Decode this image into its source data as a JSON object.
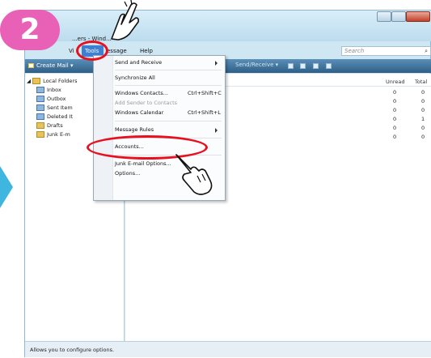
{
  "step_badge": "2",
  "window": {
    "title": "...ers - Wind...",
    "menu": {
      "view": "Vi",
      "tools": "Tools",
      "message": "essage",
      "help": "Help"
    },
    "search_placeholder": "Search",
    "toolbar": {
      "create_mail": "Create Mail",
      "send_receive": "Send/Receive"
    }
  },
  "tree": {
    "root": "Local Folders",
    "items": [
      "Inbox",
      "Outbox",
      "Sent Item",
      "Deleted It",
      "Drafts",
      "Junk E-m"
    ]
  },
  "list": {
    "headers": {
      "unread": "Unread",
      "total": "Total"
    },
    "rows": [
      {
        "unread": "0",
        "total": "0"
      },
      {
        "unread": "0",
        "total": "0"
      },
      {
        "unread": "0",
        "total": "0"
      },
      {
        "unread": "0",
        "total": "1"
      },
      {
        "unread": "0",
        "total": "0"
      },
      {
        "unread": "0",
        "total": "0"
      }
    ]
  },
  "tools_menu": {
    "send_receive": "Send and Receive",
    "synchronize_all": "Synchronize All",
    "windows_contacts": "Windows Contacts...",
    "windows_contacts_shortcut": "Ctrl+Shift+C",
    "add_sender": "Add Sender to Contacts",
    "windows_calendar": "Windows Calendar",
    "windows_calendar_shortcut": "Ctrl+Shift+L",
    "message_rules": "Message Rules",
    "accounts": "Accounts...",
    "junk_options": "Junk E-mail Options...",
    "options": "Options..."
  },
  "status_text": "Allows you to configure options.",
  "colors": {
    "badge": "#e861b7",
    "highlight_ring": "#e8101e",
    "arrow": "#3fb6e0",
    "selected_menu": "#3d7fd1"
  }
}
